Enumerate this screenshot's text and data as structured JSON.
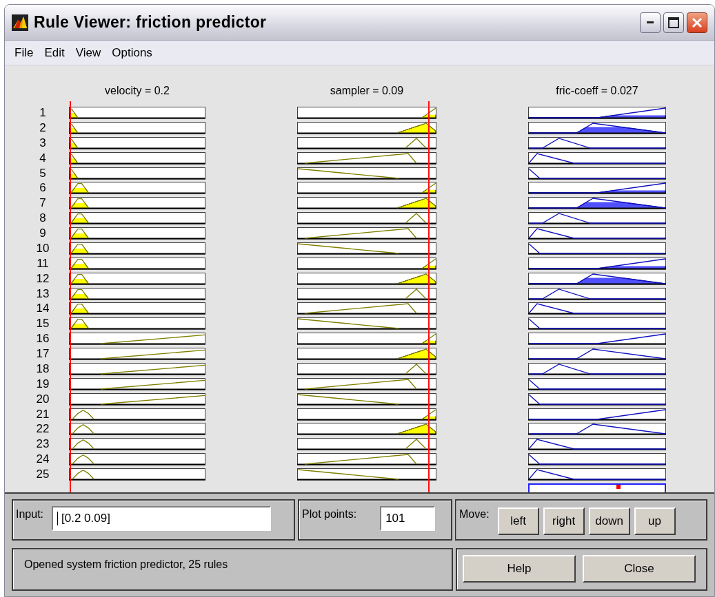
{
  "window": {
    "title": "Rule Viewer: friction predictor"
  },
  "menu": [
    {
      "label": "File"
    },
    {
      "label": "Edit"
    },
    {
      "label": "View"
    },
    {
      "label": "Options"
    }
  ],
  "inputs": [
    {
      "header": "velocity = 0.2"
    },
    {
      "header": "sampler = 0.09"
    }
  ],
  "output": {
    "header": "fric-coeff = 0.027"
  },
  "rules": [
    {
      "number": "1",
      "mfs": [
        {
          "kind": "edge",
          "fired": true
        },
        {
          "kind": "high",
          "fired": true
        },
        {
          "kind": "out-high",
          "fired": true
        }
      ]
    },
    {
      "number": "2",
      "mfs": [
        {
          "kind": "edge",
          "fired": true
        },
        {
          "kind": "peak",
          "fired": true
        },
        {
          "kind": "out-mid",
          "fired": true
        }
      ]
    },
    {
      "number": "3",
      "mfs": [
        {
          "kind": "edge",
          "fired": true
        },
        {
          "kind": "tri",
          "fired": false
        },
        {
          "kind": "out-tri",
          "fired": false
        }
      ]
    },
    {
      "number": "4",
      "mfs": [
        {
          "kind": "edge",
          "fired": true
        },
        {
          "kind": "ramp-peak",
          "fired": false
        },
        {
          "kind": "out-low",
          "fired": false
        }
      ]
    },
    {
      "number": "5",
      "mfs": [
        {
          "kind": "edge",
          "fired": true
        },
        {
          "kind": "ramp-down",
          "fired": false
        },
        {
          "kind": "out-down",
          "fired": false
        }
      ]
    },
    {
      "number": "6",
      "mfs": [
        {
          "kind": "small",
          "fired": true
        },
        {
          "kind": "high",
          "fired": true
        },
        {
          "kind": "out-high",
          "fired": true
        }
      ]
    },
    {
      "number": "7",
      "mfs": [
        {
          "kind": "small",
          "fired": true
        },
        {
          "kind": "peak",
          "fired": true
        },
        {
          "kind": "out-mid",
          "fired": true
        }
      ]
    },
    {
      "number": "8",
      "mfs": [
        {
          "kind": "small",
          "fired": true
        },
        {
          "kind": "tri",
          "fired": false
        },
        {
          "kind": "out-tri",
          "fired": false
        }
      ]
    },
    {
      "number": "9",
      "mfs": [
        {
          "kind": "small",
          "fired": true
        },
        {
          "kind": "ramp-peak",
          "fired": false
        },
        {
          "kind": "out-low",
          "fired": false
        }
      ]
    },
    {
      "number": "10",
      "mfs": [
        {
          "kind": "small",
          "fired": true
        },
        {
          "kind": "ramp-down",
          "fired": false
        },
        {
          "kind": "out-down",
          "fired": false
        }
      ]
    },
    {
      "number": "11",
      "mfs": [
        {
          "kind": "small",
          "fired": true
        },
        {
          "kind": "high",
          "fired": true
        },
        {
          "kind": "out-high",
          "fired": true
        }
      ]
    },
    {
      "number": "12",
      "mfs": [
        {
          "kind": "small",
          "fired": true
        },
        {
          "kind": "peak",
          "fired": true
        },
        {
          "kind": "out-mid",
          "fired": true
        }
      ]
    },
    {
      "number": "13",
      "mfs": [
        {
          "kind": "small",
          "fired": true
        },
        {
          "kind": "tri",
          "fired": false
        },
        {
          "kind": "out-tri",
          "fired": false
        }
      ]
    },
    {
      "number": "14",
      "mfs": [
        {
          "kind": "small",
          "fired": true
        },
        {
          "kind": "ramp-peak",
          "fired": false
        },
        {
          "kind": "out-low",
          "fired": false
        }
      ]
    },
    {
      "number": "15",
      "mfs": [
        {
          "kind": "small",
          "fired": true
        },
        {
          "kind": "ramp-down",
          "fired": false
        },
        {
          "kind": "out-down",
          "fired": false
        }
      ]
    },
    {
      "number": "16",
      "mfs": [
        {
          "kind": "ramp-up",
          "fired": false
        },
        {
          "kind": "high",
          "fired": true
        },
        {
          "kind": "out-high",
          "fired": false
        }
      ]
    },
    {
      "number": "17",
      "mfs": [
        {
          "kind": "ramp-up",
          "fired": false
        },
        {
          "kind": "peak",
          "fired": true
        },
        {
          "kind": "out-mid",
          "fired": false
        }
      ]
    },
    {
      "number": "18",
      "mfs": [
        {
          "kind": "ramp-up",
          "fired": false
        },
        {
          "kind": "tri",
          "fired": false
        },
        {
          "kind": "out-tri",
          "fired": false
        }
      ]
    },
    {
      "number": "19",
      "mfs": [
        {
          "kind": "ramp-up",
          "fired": false
        },
        {
          "kind": "ramp-peak",
          "fired": false
        },
        {
          "kind": "out-down",
          "fired": false
        }
      ]
    },
    {
      "number": "20",
      "mfs": [
        {
          "kind": "ramp-up",
          "fired": false
        },
        {
          "kind": "ramp-down",
          "fired": false
        },
        {
          "kind": "out-down",
          "fired": false
        }
      ]
    },
    {
      "number": "21",
      "mfs": [
        {
          "kind": "bump",
          "fired": false
        },
        {
          "kind": "high",
          "fired": true
        },
        {
          "kind": "out-high",
          "fired": false
        }
      ]
    },
    {
      "number": "22",
      "mfs": [
        {
          "kind": "bump",
          "fired": false
        },
        {
          "kind": "peak",
          "fired": true
        },
        {
          "kind": "out-mid",
          "fired": false
        }
      ]
    },
    {
      "number": "23",
      "mfs": [
        {
          "kind": "bump",
          "fired": false
        },
        {
          "kind": "tri",
          "fired": false
        },
        {
          "kind": "out-low",
          "fired": false
        }
      ]
    },
    {
      "number": "24",
      "mfs": [
        {
          "kind": "bump",
          "fired": false
        },
        {
          "kind": "ramp-peak",
          "fired": false
        },
        {
          "kind": "out-down",
          "fired": false
        }
      ]
    },
    {
      "number": "25",
      "mfs": [
        {
          "kind": "bump",
          "fired": false
        },
        {
          "kind": "ramp-down",
          "fired": false
        },
        {
          "kind": "out-low",
          "fired": false
        }
      ]
    }
  ],
  "controls": {
    "input": {
      "label": "Input:",
      "value": "[0.2 0.09]"
    },
    "plot_points": {
      "label": "Plot points:",
      "value": "101"
    },
    "move": {
      "label": "Move:",
      "buttons": [
        "left",
        "right",
        "down",
        "up"
      ]
    }
  },
  "status": "Opened system friction predictor, 25 rules",
  "buttons": [
    "Help",
    "Close"
  ]
}
